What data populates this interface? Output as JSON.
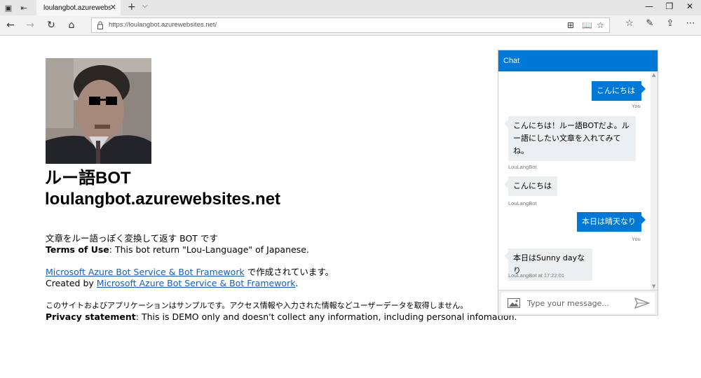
{
  "browser": {
    "tab_title": "loulangbot.azurewebsites.net",
    "url": "https://loulangbot.azurewebsites.net/"
  },
  "page": {
    "title_line1": "ルー語BOT",
    "title_line2": "loulangbot.azurewebsites.net",
    "desc_jp": "文章をルー語っぽく変換して返す BOT です",
    "terms_label": "Terms of Use",
    "terms_text": ": This bot return \"Lou-Language\" of Japanese.",
    "link_text": "Microsoft Azure Bot Service & Bot Framework",
    "made_with_jp": " で作成されています。",
    "created_by": "Created by ",
    "created_period": ".",
    "sample_jp": "このサイトおよびアプリケーションはサンプルです。アクセス情報や入力された情報などユーザーデータを取得しません。",
    "privacy_label": "Privacy statement",
    "privacy_text": ": This is DEMO only and doesn't collect any information, including personal infomation."
  },
  "chat": {
    "header": "Chat",
    "messages": [
      {
        "from": "user",
        "text": "こんにちは",
        "meta": "You"
      },
      {
        "from": "bot",
        "text": "こんにちは！ルー語BOTだよ。ルー語にしたい文章を入れてみてね。",
        "meta": "LouLangBot"
      },
      {
        "from": "bot",
        "text": "こんにちは",
        "meta": "LouLangBot"
      },
      {
        "from": "user",
        "text": "本日は晴天なり",
        "meta": "You"
      },
      {
        "from": "bot",
        "text": "本日はSunny dayなり",
        "meta": "LouLangBot at 17:22:01"
      }
    ],
    "input_placeholder": "Type your message..."
  },
  "colors": {
    "accent": "#0078d7",
    "link": "#1a5fb4",
    "bot_bubble": "#eceff1"
  }
}
